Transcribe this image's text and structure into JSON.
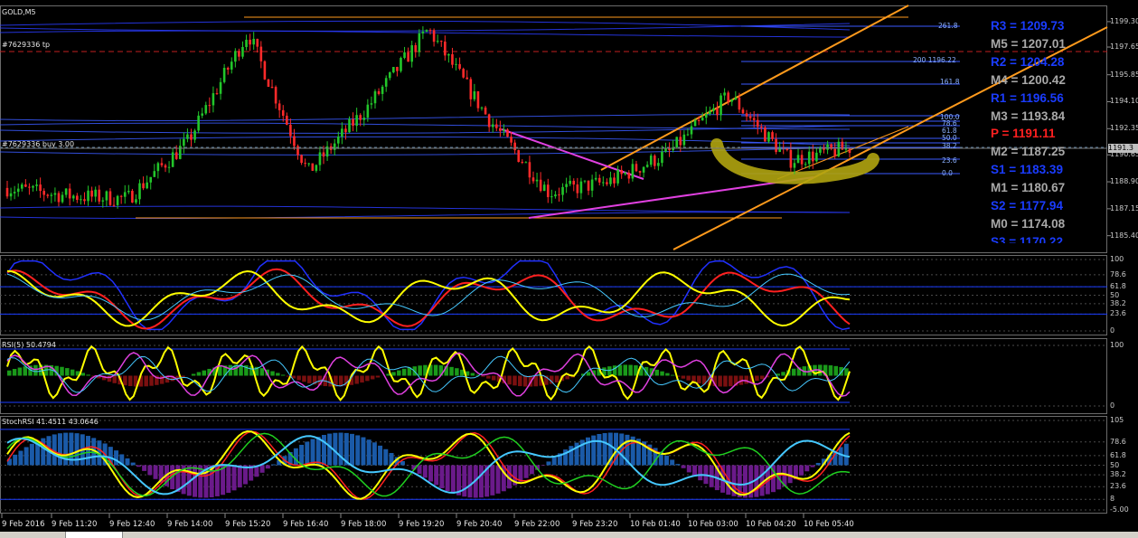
{
  "symbol": "GOLD,M5",
  "order_lines": [
    {
      "text": "#7629336 tp"
    },
    {
      "text": "#7629336 buy 3.00"
    }
  ],
  "pivots": [
    {
      "label": "R3 = 1209.73",
      "color": "#1a3cff"
    },
    {
      "label": "M5 = 1207.01",
      "color": "#a8a8a8"
    },
    {
      "label": "R2 = 1204.28",
      "color": "#1a3cff"
    },
    {
      "label": "M4 = 1200.42",
      "color": "#a8a8a8"
    },
    {
      "label": "R1 = 1196.56",
      "color": "#1a3cff"
    },
    {
      "label": "M3 = 1193.84",
      "color": "#a8a8a8"
    },
    {
      "label": "P  = 1191.11",
      "color": "#ff2020"
    },
    {
      "label": "M2 = 1187.25",
      "color": "#a8a8a8"
    },
    {
      "label": "S1 = 1183.39",
      "color": "#1a3cff"
    },
    {
      "label": "M1 = 1180.67",
      "color": "#a8a8a8"
    },
    {
      "label": "S2 = 1177.94",
      "color": "#1a3cff"
    },
    {
      "label": "M0 = 1174.08",
      "color": "#a8a8a8"
    },
    {
      "label": "S3 = 1170.22",
      "color": "#1a3cff"
    }
  ],
  "fib_labels": [
    "261.8",
    "200  1196.22",
    "161.8",
    "100.0",
    "78.6",
    "61.8",
    "50.0",
    "38.2",
    "23.6",
    "0.0"
  ],
  "price_axis": [
    "1199.30",
    "1197.65",
    "1195.85",
    "1194.10",
    "1192.35",
    "1190.65",
    "1188.90",
    "1187.15",
    "1185.40"
  ],
  "current_price": "1191.3",
  "stoch_axis": [
    "100",
    "78.6",
    "61.8",
    "50",
    "38.2",
    "23.6",
    "0"
  ],
  "rsi_title": "RSI(5) 50.4794",
  "rsi_axis": [
    "100",
    "0"
  ],
  "stochrsi_title": "StochRSI 41.4511 43.0646",
  "stochrsi_axis": [
    "105",
    "78.6",
    "61.8",
    "50",
    "38.2",
    "23.6",
    "8",
    "-5.00"
  ],
  "time_axis": [
    "9 Feb 2016",
    "9 Feb 11:20",
    "9 Feb 12:40",
    "9 Feb 14:00",
    "9 Feb 15:20",
    "9 Feb 16:40",
    "9 Feb 18:00",
    "9 Feb 19:20",
    "9 Feb 20:40",
    "9 Feb 22:00",
    "9 Feb 23:20",
    "10 Feb 01:40",
    "10 Feb 03:00",
    "10 Feb 04:20",
    "10 Feb 05:40"
  ],
  "colors": {
    "bull": "#22c52a",
    "bear": "#ff2a2a",
    "channel": "#ff9a1c",
    "trend": "#e040e0",
    "highlight": "#b0a410",
    "bands": "#2a3cff",
    "yellow": "#ffff00",
    "cyan": "#45c8ff",
    "green_hist": "#1a9a1a",
    "maroon_hist": "#7a1010",
    "purple_hist": "#6a1a8a",
    "blue_hist": "#1a5aa8"
  },
  "chart_data": {
    "type": "candlestick",
    "title": "GOLD,M5",
    "ylim": [
      1184.5,
      1200.0
    ],
    "price_ticks": [
      1199.3,
      1197.65,
      1195.85,
      1194.1,
      1192.35,
      1190.65,
      1188.9,
      1187.15,
      1185.4
    ],
    "x": [
      "9 Feb 2016",
      "9 Feb 11:20",
      "9 Feb 12:40",
      "9 Feb 14:00",
      "9 Feb 15:20",
      "9 Feb 16:40",
      "9 Feb 18:00",
      "9 Feb 19:20",
      "9 Feb 20:40",
      "9 Feb 22:00",
      "9 Feb 23:20",
      "10 Feb 01:40",
      "10 Feb 03:00",
      "10 Feb 04:20",
      "10 Feb 05:40"
    ],
    "close_approx": [
      1188.5,
      1188.0,
      1187.8,
      1191.5,
      1198.6,
      1189.5,
      1193.8,
      1198.8,
      1193.0,
      1188.2,
      1188.9,
      1190.8,
      1194.5,
      1190.3,
      1191.1
    ],
    "current_price": 1191.3,
    "pivot_levels": {
      "R3": 1209.73,
      "M5": 1207.01,
      "R2": 1204.28,
      "M4": 1200.42,
      "R1": 1196.56,
      "M3": 1193.84,
      "P": 1191.11,
      "M2": 1187.25,
      "S1": 1183.39,
      "M1": 1180.67,
      "S2": 1177.94,
      "M0": 1174.08,
      "S3": 1170.22
    },
    "indicators": [
      {
        "name": "RSI(5)",
        "value": 50.4794,
        "ylim": [
          0,
          100
        ]
      },
      {
        "name": "StochRSI",
        "values": [
          41.4511,
          43.0646
        ],
        "ylim": [
          -5,
          105
        ]
      }
    ]
  }
}
